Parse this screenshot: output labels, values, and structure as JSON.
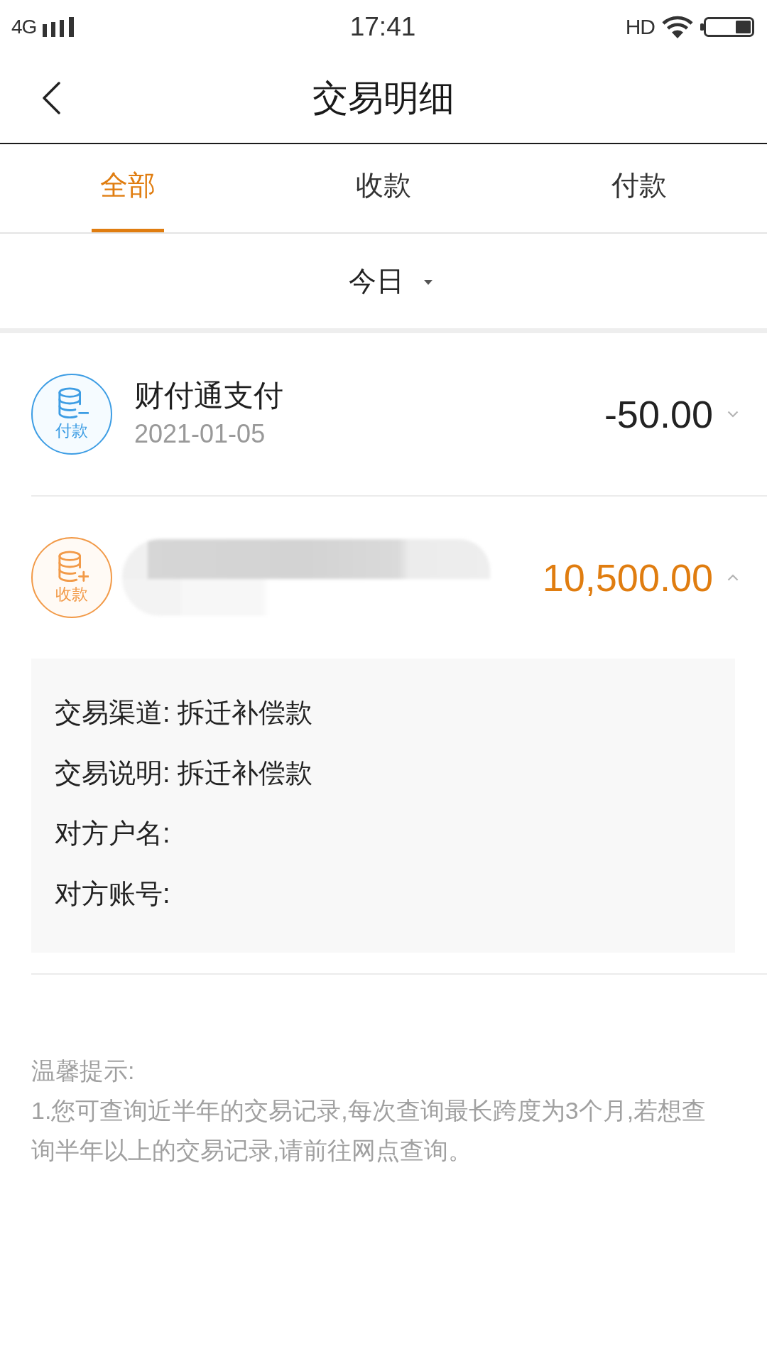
{
  "status_bar": {
    "network": "4G",
    "time": "17:41",
    "label": "HD"
  },
  "header": {
    "title": "交易明细"
  },
  "tabs": [
    {
      "label": "全部",
      "selected": true
    },
    {
      "label": "收款",
      "selected": false
    },
    {
      "label": "付款",
      "selected": false
    }
  ],
  "filter": {
    "label": "今日"
  },
  "transactions": [
    {
      "kind": "payment",
      "badge": "付款",
      "name": "财付通支付",
      "date": "2021-01-05",
      "amount": "-50.00",
      "blurred": false,
      "expanded": false
    },
    {
      "kind": "income",
      "badge": "收款",
      "amount": "10,500.00",
      "blurred": true,
      "expanded": true,
      "details": [
        {
          "label": "交易渠道:",
          "value": "拆迁补偿款"
        },
        {
          "label": "交易说明:",
          "value": "拆迁补偿款"
        },
        {
          "label": "对方户名:"
        },
        {
          "label": "对方账号:"
        }
      ]
    }
  ],
  "tips": {
    "title": "温馨提示:",
    "items": [
      "1.您可查询近半年的交易记录,每次查询最长跨度为3个月,若想查询半年以上的交易记录,请前往网点查询。"
    ]
  }
}
